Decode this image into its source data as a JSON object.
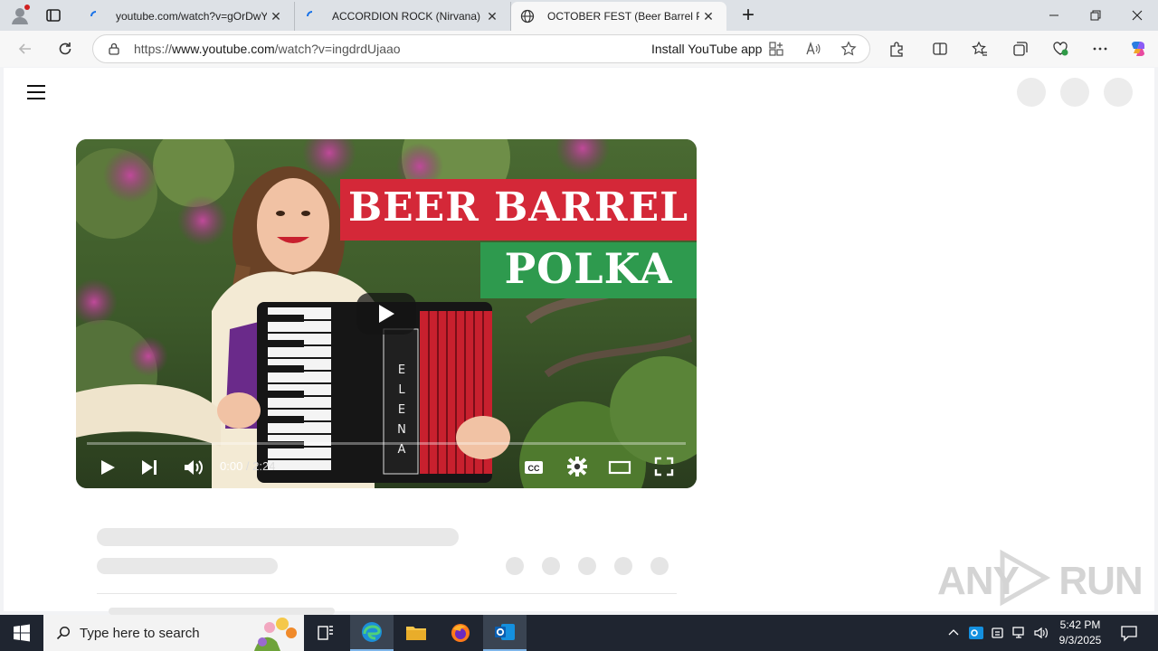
{
  "browser": {
    "tabs": [
      {
        "title": "youtube.com/watch?v=gOrDwYa",
        "state": "inactive"
      },
      {
        "title": "ACCORDION ROCK (Nirvana) - CC",
        "state": "inactive"
      },
      {
        "title": "OCTOBER FEST (Beer Barrel Polka",
        "state": "active"
      }
    ],
    "new_tab_glyph": "+",
    "close_glyph": "✕",
    "address": {
      "prefix": "https://",
      "host": "www.youtube.com",
      "path": "/watch?v=ingdrdUjaao"
    },
    "install_label": "Install YouTube app"
  },
  "video": {
    "title_line1": "BEER BARREL",
    "title_line2": "POLKA",
    "accordion_text": "ELENA",
    "time_current": "0:00",
    "time_separator": " / ",
    "time_total": "2:24",
    "progress": 0,
    "colors": {
      "title_red": "#d42838",
      "title_green": "#2e9a4e"
    }
  },
  "watermark": {
    "text": "ANY RUN"
  },
  "taskbar": {
    "search_placeholder": "Type here to search",
    "time": "5:42 PM",
    "date": "9/3/2025"
  }
}
